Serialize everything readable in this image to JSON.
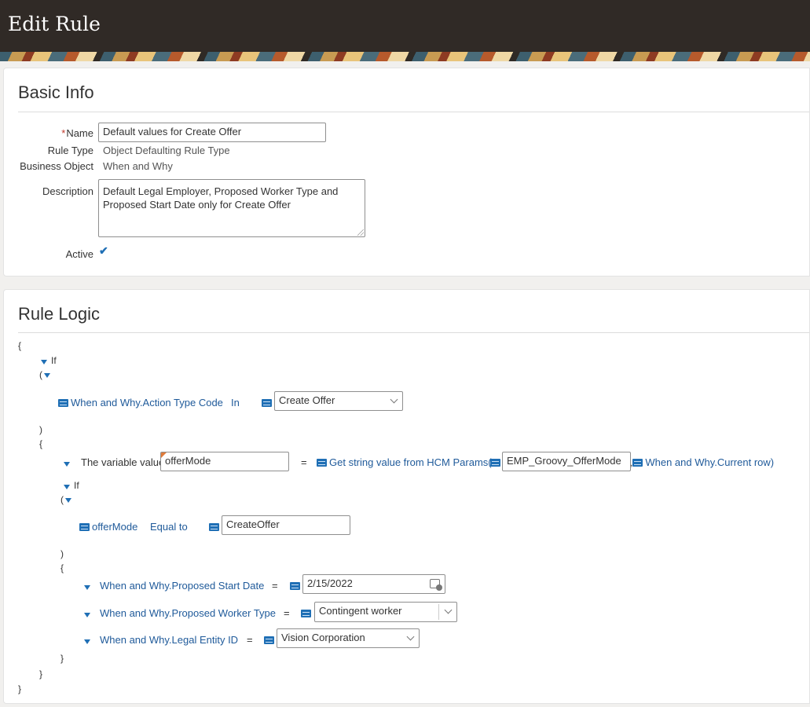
{
  "header": {
    "title": "Edit Rule"
  },
  "basic_info": {
    "title": "Basic Info",
    "name_label": "Name",
    "name_required_mark": "*",
    "name_value": "Default values for Create Offer",
    "rule_type_label": "Rule Type",
    "rule_type_value": "Object Defaulting Rule Type",
    "business_object_label": "Business Object",
    "business_object_value": "When and Why",
    "description_label": "Description",
    "description_value": "Default Legal Employer, Proposed Worker Type and Proposed Start Date only for Create Offer",
    "active_label": "Active",
    "active_checked": true,
    "check_glyph": "✔"
  },
  "rule_logic": {
    "title": "Rule Logic",
    "open_brace": "{",
    "close_brace": "}",
    "open_paren": "(",
    "close_paren": ")",
    "if_keyword": "If",
    "condition1": {
      "field": "When and Why.Action Type Code",
      "operator": "In",
      "value": "Create Offer"
    },
    "variable_stmt": {
      "label": "The variable value",
      "name": "offerMode",
      "equals": "=",
      "function": "Get string value from HCM Params(",
      "param1": "EMP_Groovy_OfferMode",
      "param_sep": ",",
      "param2": "When and Why.Current row)"
    },
    "condition2": {
      "field": "offerMode",
      "operator": "Equal to",
      "value": "CreateOffer"
    },
    "assignments": [
      {
        "field": "When and Why.Proposed Start Date",
        "equals": "=",
        "value": "2/15/2022"
      },
      {
        "field": "When and Why.Proposed Worker Type",
        "equals": "=",
        "value": "Contingent worker"
      },
      {
        "field": "When and Why.Legal Entity ID",
        "equals": "=",
        "value": "Vision Corporation"
      }
    ]
  }
}
